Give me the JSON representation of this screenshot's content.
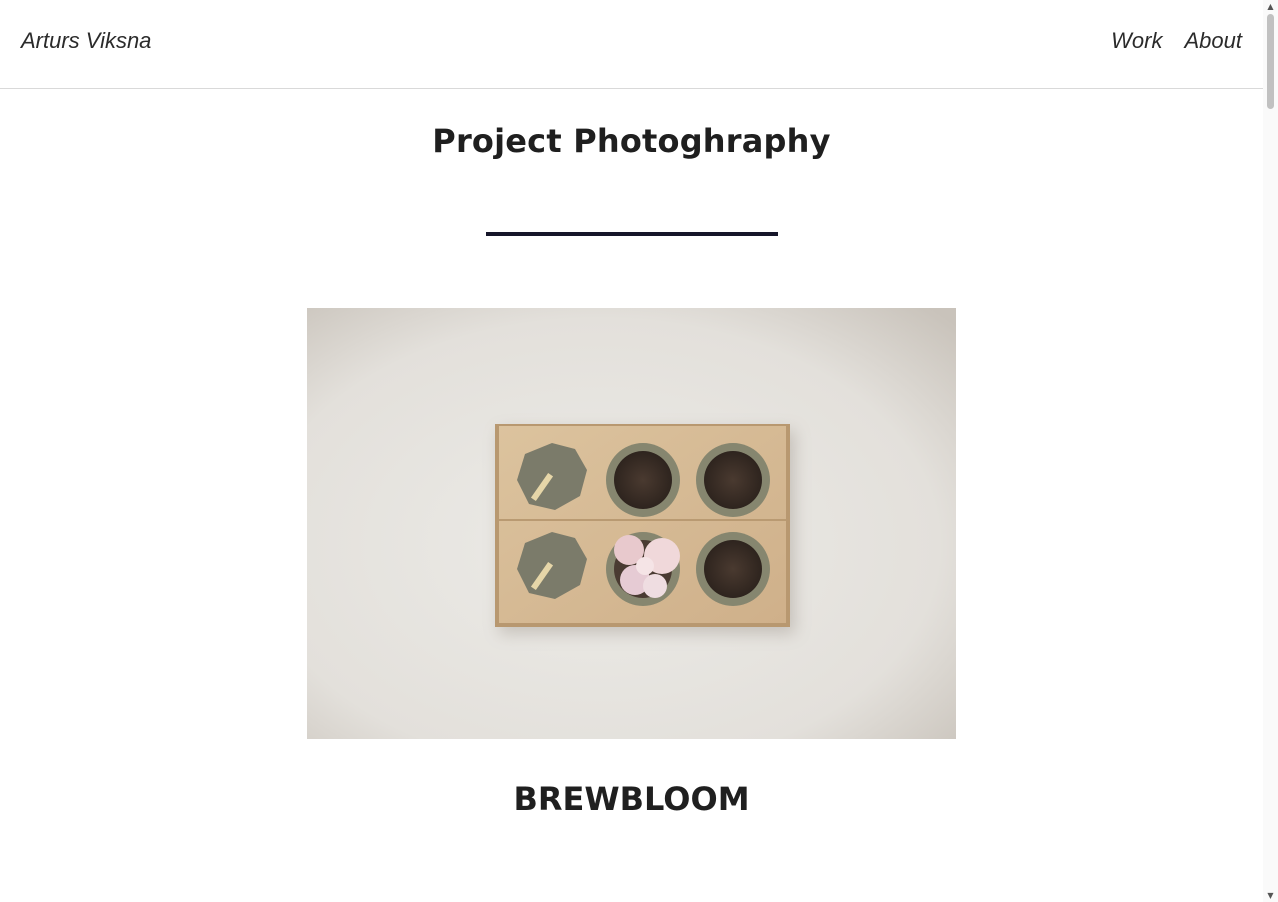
{
  "header": {
    "brand": "Arturs Viksna",
    "nav": [
      {
        "label": "Work"
      },
      {
        "label": "About"
      }
    ]
  },
  "main": {
    "title": "Project Photoghraphy",
    "project": {
      "name": "BREWBLOOM"
    }
  },
  "colors": {
    "divider": "#16162a",
    "text": "#1f1f1f"
  },
  "icons": {
    "scroll_up": "triangle-up",
    "scroll_down": "triangle-down"
  }
}
